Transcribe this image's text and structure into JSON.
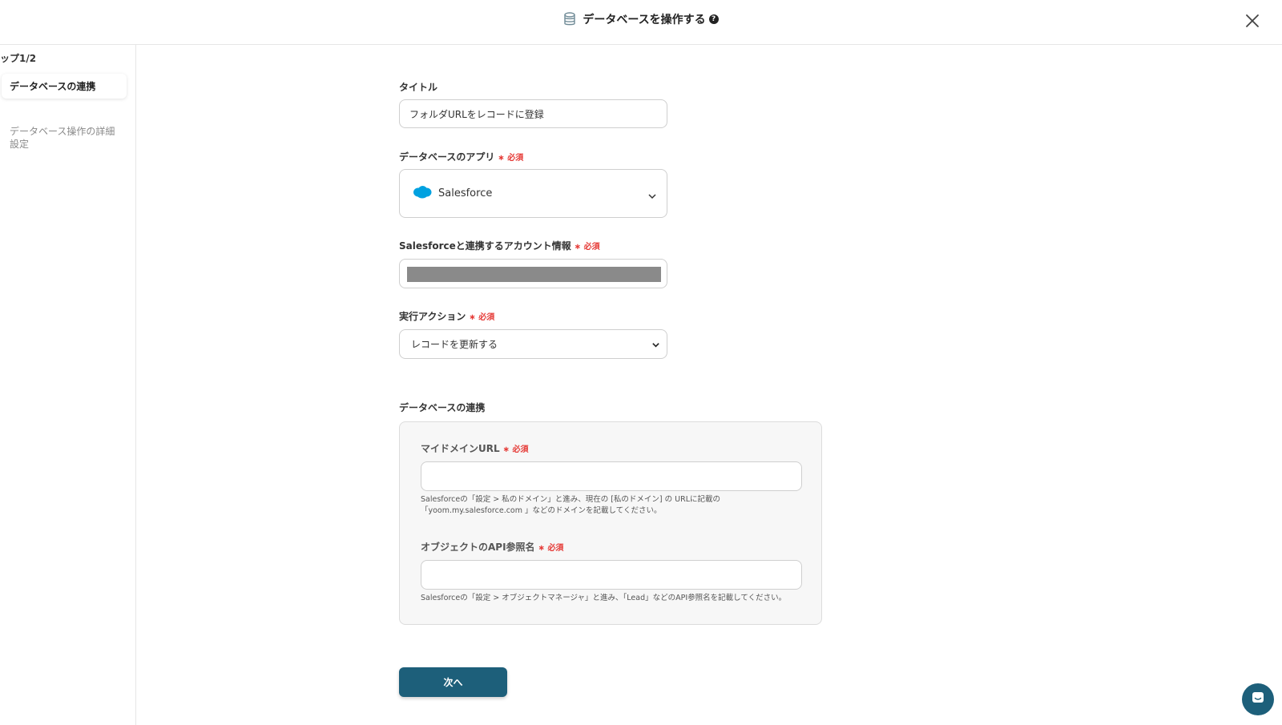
{
  "header": {
    "title": "データベースを操作する",
    "db_icon": "database-icon",
    "help_icon": "question-circle-icon",
    "help_glyph": "?",
    "close_icon": "close-icon"
  },
  "sidebar": {
    "step": "ップ1/2",
    "items": [
      {
        "label": "データベースの連携",
        "active": true
      },
      {
        "label": "データベース操作の詳細設定",
        "active": false
      }
    ]
  },
  "form": {
    "title_label": "タイトル",
    "title_value": "フォルダURLをレコードに登録",
    "app_label": "データベースのアプリ",
    "required": "必須",
    "app_value": "Salesforce",
    "account_label": "Salesforceと連携するアカウント情報",
    "action_label": "実行アクション",
    "action_value": "レコードを更新する"
  },
  "db_link": {
    "section_title": "データベースの連携",
    "domain_label": "マイドメインURL",
    "domain_hint_1": "Salesforceの「設定 > 私のドメイン」と進み、現在の [私のドメイン] の URLに記載の",
    "domain_hint_2": "「yoom.my.salesforce.com 」などのドメインを記載してください。",
    "object_label": "オブジェクトのAPI参照名",
    "object_hint": "Salesforceの「設定 > オブジェクトマネージャ」と進み、「Lead」などのAPI参照名を記載してください。"
  },
  "footer": {
    "next_label": "次へ",
    "chat_icon": "chat-icon"
  },
  "colors": {
    "primary": "#1d5f7a",
    "required": "#e53935",
    "salesforce": "#00a1e0"
  }
}
